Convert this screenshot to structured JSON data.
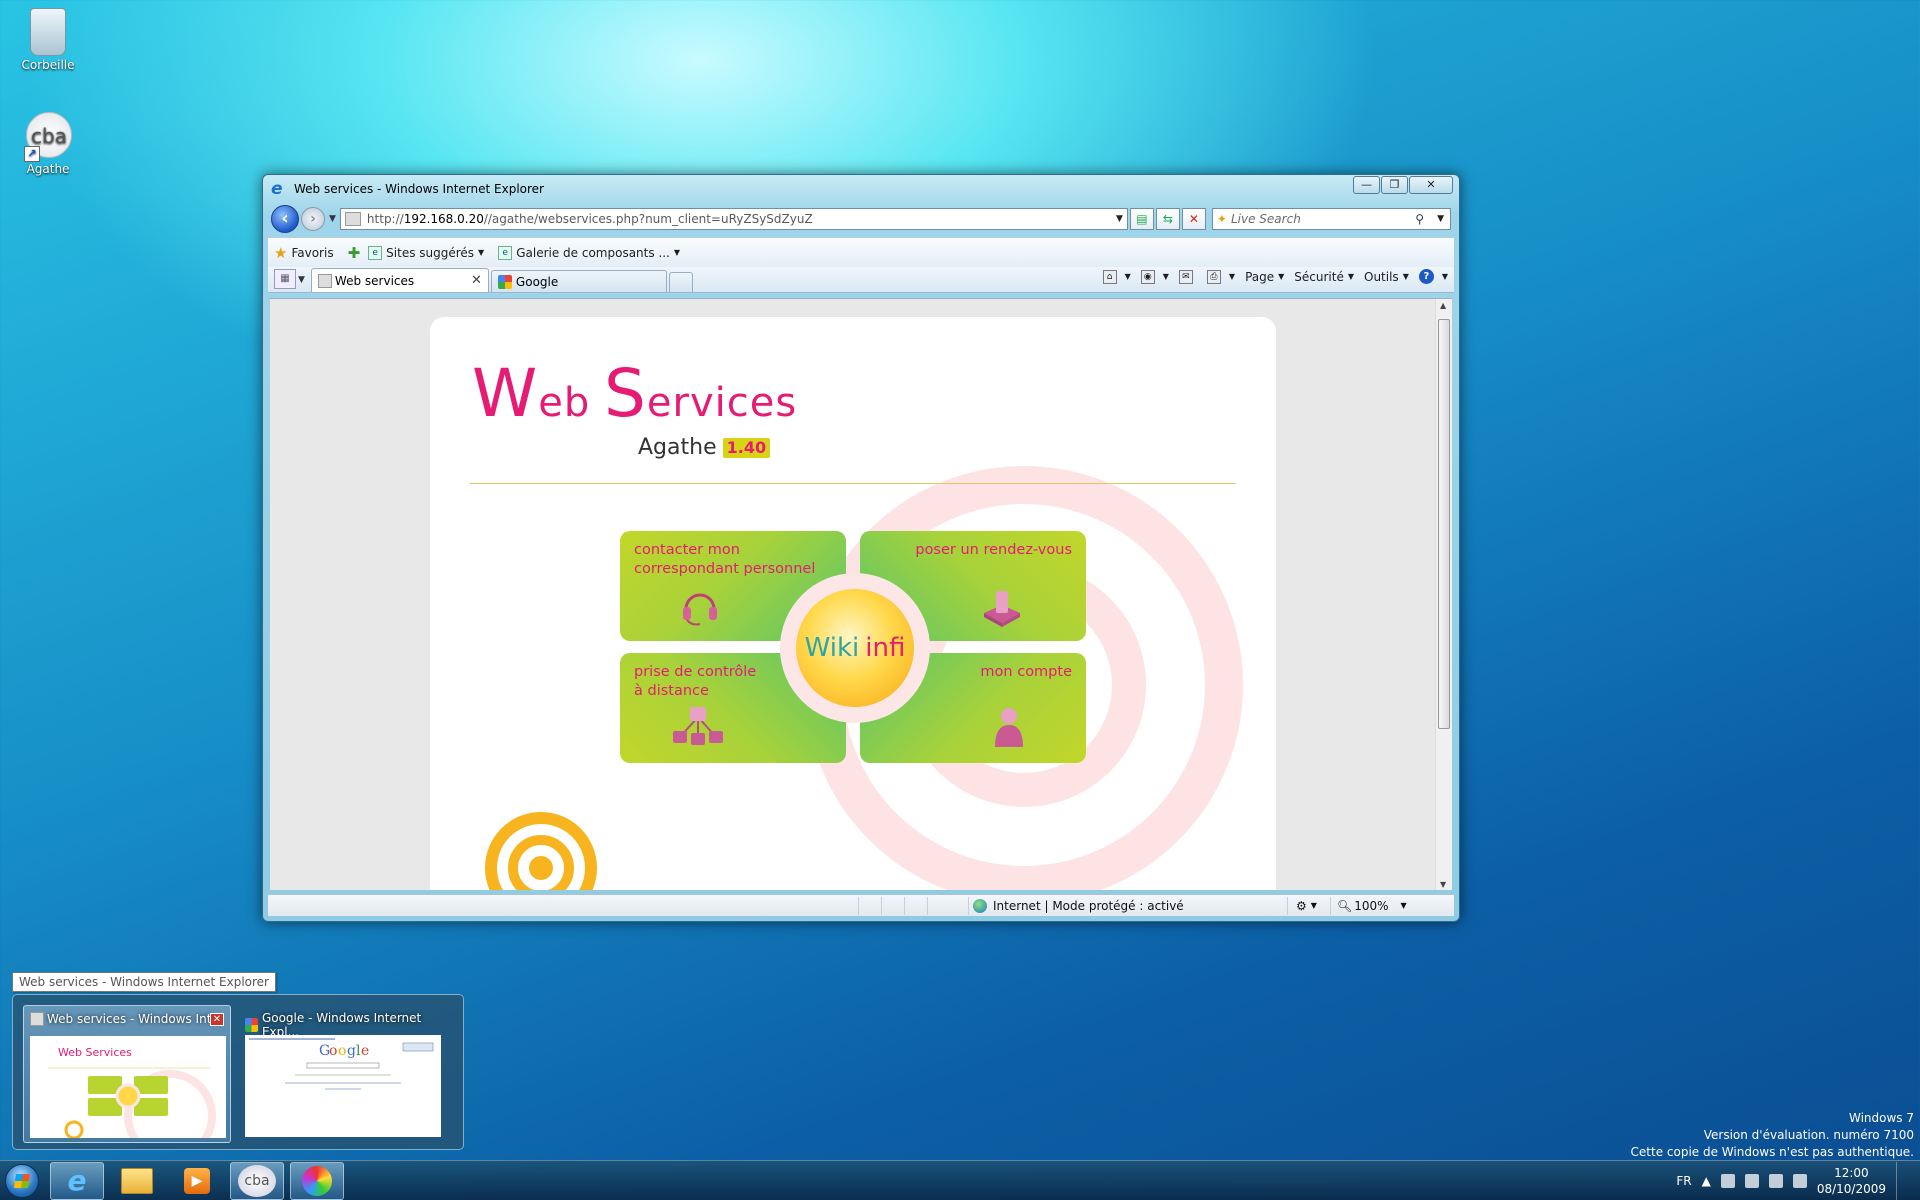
{
  "desktop": {
    "icons": [
      {
        "label": "Corbeille"
      },
      {
        "label": "Agathe",
        "glyph": "cba"
      }
    ]
  },
  "window": {
    "title": "Web services - Windows Internet Explorer",
    "controls": {
      "minimize": "—",
      "restore": "❐",
      "close": "✕"
    },
    "address": {
      "prefix": "http://",
      "host": "192.168.0.20",
      "path": "//agathe/webservices.php?num_client=uRyZSySdZyuZ"
    },
    "search_placeholder": "Live Search",
    "favorites": {
      "favoris": "Favoris",
      "suggested": "Sites suggérés",
      "gallery": "Galerie de composants ..."
    },
    "tabs": [
      {
        "label": "Web services",
        "active": true
      },
      {
        "label": "Google",
        "active": false
      }
    ],
    "commands": {
      "page": "Page",
      "security": "Sécurité",
      "tools": "Outils"
    },
    "status": {
      "zone": "Internet | Mode protégé : activé",
      "zoom": "100%"
    }
  },
  "webpage": {
    "title_w": "W",
    "title_eb": "eb ",
    "title_s": "S",
    "title_ervices": "ervices",
    "subtitle": "Agathe",
    "version": "1.40",
    "tiles": [
      {
        "label": "contacter mon correspondant personnel",
        "icon": "headset-icon"
      },
      {
        "label": "poser un rendez-vous",
        "icon": "inbox-icon"
      },
      {
        "label_line1": "prise de contrôle",
        "label_line2": "à distance",
        "icon": "network-icon"
      },
      {
        "label": "mon compte",
        "icon": "user-icon"
      }
    ],
    "hub": {
      "wiki": "Wiki",
      "infi": "infi"
    },
    "colors": {
      "brand_pink": "#e61b73",
      "tile_green": "#b8d430",
      "hub_orange": "#f7a614"
    }
  },
  "taskbar": {
    "tooltip": "Web services - Windows Internet Explorer",
    "previews": [
      {
        "title": "Web services - Windows Int..."
      },
      {
        "title": "Google - Windows Internet Expl..."
      }
    ],
    "cba_label": "cba",
    "tray": {
      "lang": "FR",
      "time": "12:00",
      "date": "08/10/2009"
    }
  },
  "watermark": {
    "line1": "Windows 7",
    "line2": "Version d'évaluation. numéro 7100",
    "line3": "Cette copie de Windows n'est pas authentique."
  }
}
